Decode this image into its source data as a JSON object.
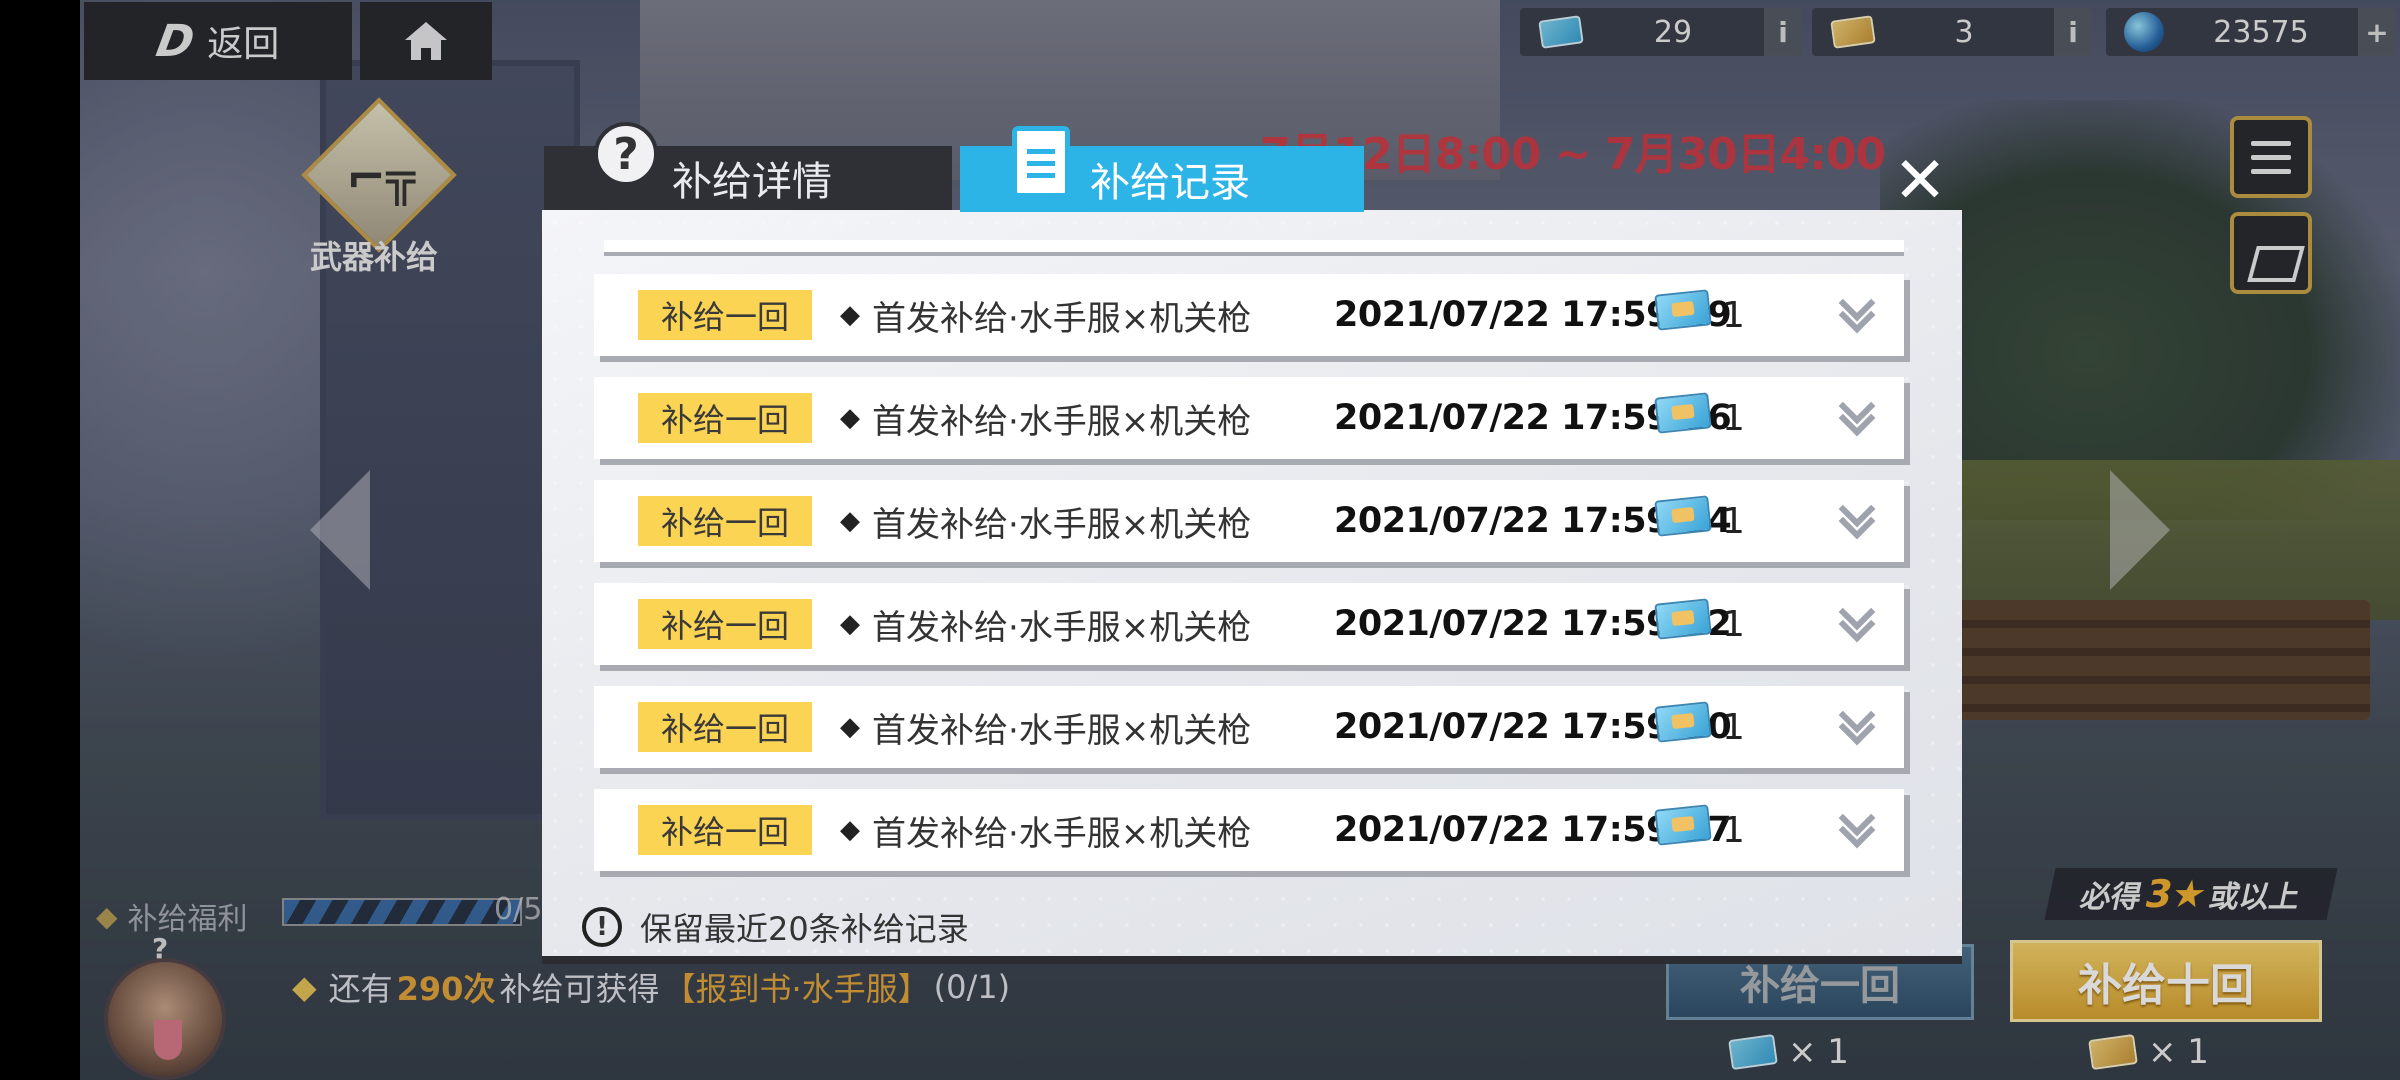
{
  "header": {
    "back_label": "返回",
    "currencies": [
      {
        "icon": "blue-ticket-icon",
        "value": "29"
      },
      {
        "icon": "gold-ticket-icon",
        "value": "3"
      },
      {
        "icon": "crystal-orb-icon",
        "value": "23575"
      }
    ]
  },
  "banner": {
    "date_range": "7月12日8:00 ~ 7月30日4:00",
    "weapon_supply_label": "武器补给"
  },
  "modal": {
    "tabs": [
      {
        "label": "补给详情",
        "active": false
      },
      {
        "label": "补给记录",
        "active": true
      }
    ],
    "records": [
      {
        "type": "补给一回",
        "name": "首发补给·水手服×机关枪",
        "time": "2021/07/22 17:59:49",
        "qty": "1"
      },
      {
        "type": "补给一回",
        "name": "首发补给·水手服×机关枪",
        "time": "2021/07/22 17:59:36",
        "qty": "1"
      },
      {
        "type": "补给一回",
        "name": "首发补给·水手服×机关枪",
        "time": "2021/07/22 17:59:34",
        "qty": "1"
      },
      {
        "type": "补给一回",
        "name": "首发补给·水手服×机关枪",
        "time": "2021/07/22 17:59:32",
        "qty": "1"
      },
      {
        "type": "补给一回",
        "name": "首发补给·水手服×机关枪",
        "time": "2021/07/22 17:59:30",
        "qty": "1"
      },
      {
        "type": "补给一回",
        "name": "首发补给·水手服×机关枪",
        "time": "2021/07/22 17:59:27",
        "qty": "1"
      }
    ],
    "footer_note": "保留最近20条补给记录"
  },
  "bottom": {
    "welfare_label": "补给福利",
    "welfare_count": "0/5",
    "remaining_prefix": "还有",
    "remaining_count": "290次",
    "remaining_middle": "补给可获得",
    "remaining_item": "【报到书·水手服】",
    "remaining_progress": "(0/1)",
    "guarantee_prefix": "必得",
    "guarantee_stars": "3★",
    "guarantee_suffix": "或以上",
    "pull_one_label": "补给一回",
    "pull_ten_label": "补给十回",
    "pull_one_cost": "× 1",
    "pull_ten_cost": "× 1"
  },
  "colors": {
    "active_tab": "#2db4e7",
    "badge": "#fbd454",
    "highlight_orange": "#e4a53d"
  }
}
